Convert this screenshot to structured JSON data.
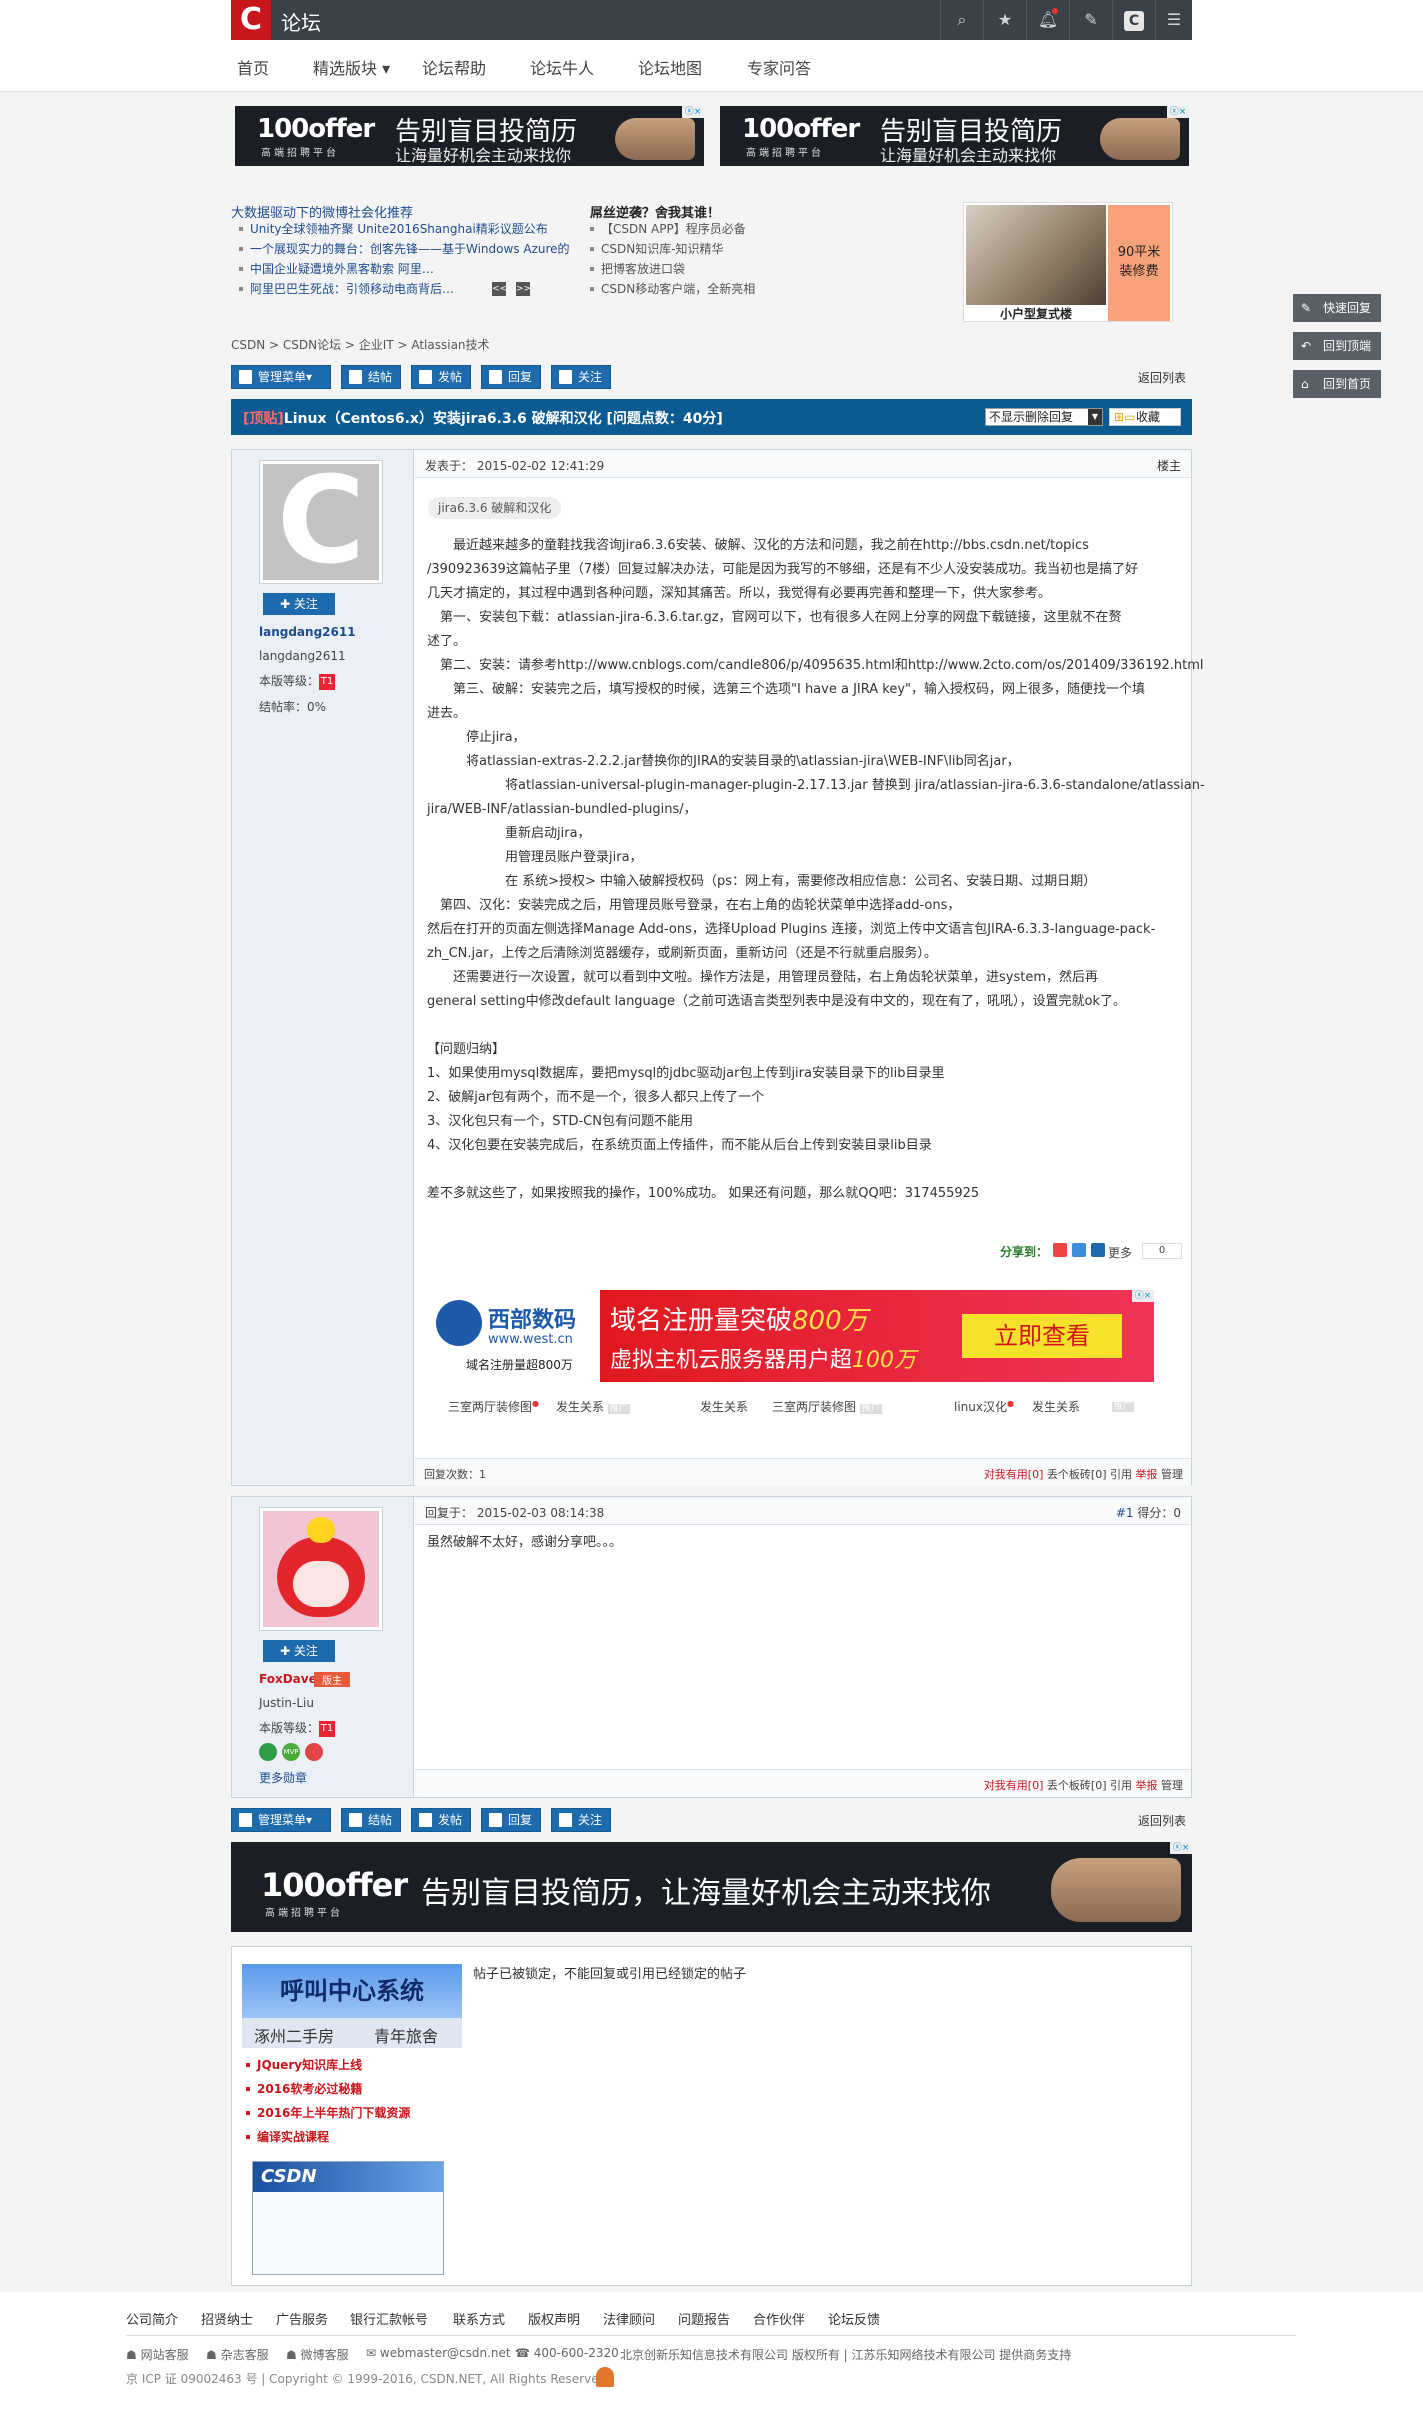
{
  "header": {
    "logo": "C",
    "title": "论坛",
    "icons": [
      "search-icon",
      "star-icon",
      "bell-icon",
      "edit-icon",
      "csdn-icon",
      "menu-icon"
    ]
  },
  "nav": {
    "items": [
      "首页",
      "精选版块 ▾",
      "论坛帮助",
      "论坛牛人",
      "论坛地图",
      "专家问答"
    ]
  },
  "ad100": {
    "brand": "100offer",
    "brand_sub": "高端招聘平台",
    "slogan": "告别盲目投简历",
    "slogan2": "让海量好机会主动来找你",
    "slogan_full": "告别盲目投简历，让海量好机会主动来找你"
  },
  "hot": {
    "left_head": "大数据驱动下的微博社会化推荐",
    "left_items": [
      "Unity全球领袖齐聚 Unite2016Shanghai精彩议题公布",
      "一个展现实力的舞台：创客先锋——基于Windows Azure的",
      "中国企业疑遭境外黑客勒索 阿里…",
      "阿里巴巴生死战：引领移动电商背后…"
    ],
    "pager": [
      "<<",
      ">>"
    ],
    "right_head": "屌丝逆袭？舍我其谁！",
    "right_items": [
      "【CSDN APP】程序员必备",
      "CSDN知识库-知识精华",
      "把博客放进口袋",
      "CSDN移动客户端，全新亮相"
    ],
    "img_caption": "小户型复式楼",
    "img_promo": "90平米\n装修费",
    "img_promo_a": "90平米",
    "img_promo_b": "装修费"
  },
  "breadcrumb": "CSDN > CSDN论坛 > 企业IT > Atlassian技术",
  "toolbar": {
    "manage": "管理菜单▾",
    "close": "结帖",
    "post": "发帖",
    "reply": "回复",
    "follow": "关注",
    "back": "返回列表"
  },
  "side_buttons": [
    "快速回复",
    "回到顶端",
    "回到首页"
  ],
  "thread": {
    "tag": "[顶贴]",
    "title": "Linux（Centos6.x）安装jira6.3.6 破解和汉化 [问题点数：40分]",
    "filter": "不显示删除回复",
    "collect": "收藏"
  },
  "post1": {
    "date": "发表于： 2015-02-02 12:41:29",
    "floor": "楼主",
    "follow": "✚ 关注",
    "user": "langdang2611",
    "nick": "langdang2611",
    "level_label": "本版等级：",
    "rate": "结帖率：0%",
    "tag": "jira6.3.6 破解和汉化",
    "lines": [
      "　　最近越来越多的童鞋找我咨询jira6.3.6安装、破解、汉化的方法和问题，我之前在http://bbs.csdn.net/topics",
      "/390923639这篇帖子里（7楼）回复过解决办法，可能是因为我写的不够细，还是有不少人没安装成功。我当初也是搞了好",
      "几天才搞定的，其过程中遇到各种问题，深知其痛苦。所以，我觉得有必要再完善和整理一下，供大家参考。",
      "　第一、安装包下载：atlassian-jira-6.3.6.tar.gz，官网可以下，也有很多人在网上分享的网盘下载链接，这里就不在赘",
      "述了。",
      "　第二、安装：请参考http://www.cnblogs.com/candle806/p/4095635.html和http://www.2cto.com/os/201409/336192.html",
      "　　第三、破解：安装完之后，填写授权的时候，选第三个选项\"I have a JIRA key\"，输入授权码，网上很多，随便找一个填",
      "进去。",
      "　　　停止jira，",
      "　　　将atlassian-extras-2.2.2.jar替换你的JIRA的安装目录的\\atlassian-jira\\WEB-INF\\lib同名jar，",
      "　　　　　　将atlassian-universal-plugin-manager-plugin-2.17.13.jar 替换到 jira/atlassian-jira-6.3.6-standalone/atlassian-",
      "jira/WEB-INF/atlassian-bundled-plugins/，",
      "　　　　　　重新启动jira，",
      "　　　　　　用管理员账户登录jira，",
      "　　　　　　在 系统>授权> 中输入破解授权码（ps：网上有，需要修改相应信息：公司名、安装日期、过期日期）",
      "　第四、汉化：安装完成之后，用管理员账号登录，在右上角的齿轮状菜单中选择add-ons，",
      "然后在打开的页面左侧选择Manage Add-ons，选择Upload Plugins 连接，浏览上传中文语言包JIRA-6.3.3-language-pack-",
      "zh_CN.jar，上传之后清除浏览器缓存，或刷新页面，重新访问（还是不行就重启服务）。",
      "　　还需要进行一次设置，就可以看到中文啦。操作方法是，用管理员登陆，右上角齿轮状菜单，进system，然后再",
      "general setting中修改default language（之前可选语言类型列表中是没有中文的，现在有了，吼吼），设置完就ok了。",
      "",
      "【问题归纳】",
      "1、如果使用mysql数据库，要把mysql的jdbc驱动jar包上传到jira安装目录下的lib目录里",
      "2、破解jar包有两个，而不是一个，很多人都只上传了一个",
      "3、汉化包只有一个，STD-CN包有问题不能用",
      "4、汉化包要在安装完成后，在系统页面上传插件，而不能从后台上传到安装目录lib目录",
      "",
      "差不多就这些了，如果按照我的操作，100%成功。 如果还有问题，那么就QQ吧：317455925"
    ],
    "share": "分享到：",
    "share_more": "更多",
    "share_count": "0",
    "ad_west": {
      "brand": "西部数码",
      "domain": "www.west.cn",
      "sub": "域名注册量超800万",
      "line1": "域名注册量突破",
      "line1_num": "800万",
      "line2": "虚拟主机云服务器用户超",
      "line2_num": "100万",
      "cta": "立即查看"
    },
    "related": [
      "三室两厅装修图",
      "发生关系",
      "发生关系",
      "三室两厅装修图",
      "linux汉化",
      "发生关系"
    ],
    "related_tag": "推广",
    "reply_count": "回复次数：1",
    "actions": {
      "useful": "对我有用[0]",
      "brick": "丢个板砖[0]",
      "quote": "引用",
      "report": "举报",
      "manage": "管理"
    }
  },
  "post2": {
    "date": "回复于： 2015-02-03 08:14:38",
    "floor": "#1",
    "score": "得分：0",
    "follow": "✚ 关注",
    "user": "FoxDave",
    "badge": "版主",
    "nick": "Justin-Liu",
    "level_label": "本版等级：",
    "more_medals": "更多勋章",
    "text": "虽然破解不太好，感谢分享吧。。。",
    "actions": {
      "useful": "对我有用[0]",
      "brick": "丢个板砖[0]",
      "quote": "引用",
      "report": "举报",
      "manage": "管理"
    }
  },
  "locked": {
    "notice": "帖子已被锁定，不能回复或引用已经锁定的帖子",
    "ad_title": "呼叫中心系统",
    "ad_left": "涿州二手房",
    "ad_right": "青年旅舍",
    "links": [
      "JQuery知识库上线",
      "2016软考必过秘籍",
      "2016年上半年热门下载资源",
      "编译实战课程"
    ],
    "csdn": "CSDN"
  },
  "footer": {
    "links": [
      "公司简介",
      "招贤纳士",
      "广告服务",
      "银行汇款帐号",
      "联系方式",
      "版权声明",
      "法律顾问",
      "问题报告",
      "合作伙伴",
      "论坛反馈"
    ],
    "contact": [
      "网站客服",
      "杂志客服",
      "微博客服",
      "webmaster@csdn.net",
      "400-600-2320"
    ],
    "company": "北京创新乐知信息技术有限公司 版权所有 | 江苏乐知网络技术有限公司 提供商务支持",
    "icp": "京 ICP 证 09002463 号 | Copyright © 1999-2016, CSDN.NET, All Rights Reserved"
  },
  "colors": {
    "brand_red": "#c8161d",
    "nav_dark": "#3a4149",
    "title_blue": "#0b5a92",
    "button_blue": "#1d6bad"
  }
}
